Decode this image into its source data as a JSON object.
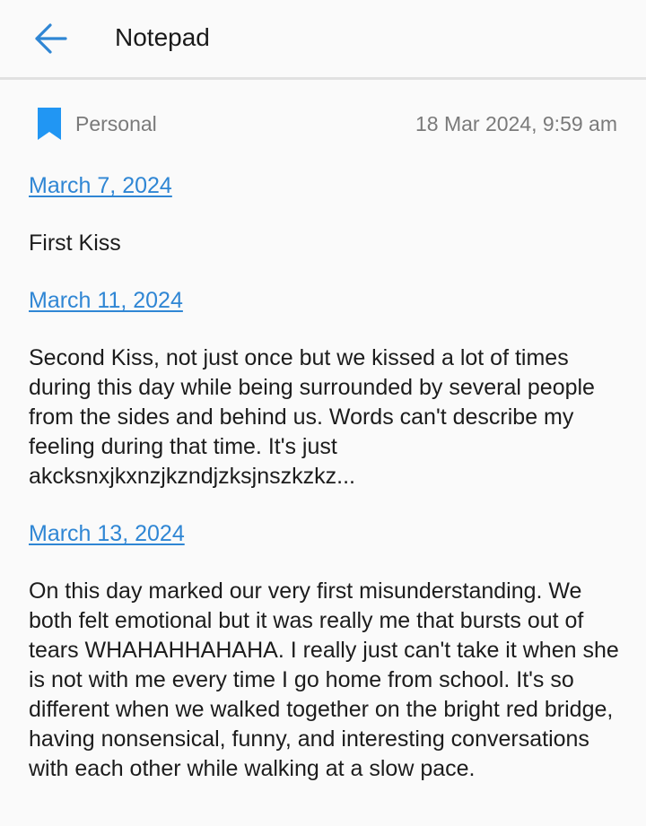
{
  "header": {
    "back_icon": "arrow-left-icon",
    "title": "Notepad"
  },
  "meta": {
    "bookmark_icon": "bookmark-icon",
    "bookmark_color": "#2196f3",
    "category": "Personal",
    "timestamp": "18 Mar 2024, 9:59 am"
  },
  "colors": {
    "link": "#2f86d4",
    "accent": "#2196f3",
    "background": "#fafafa"
  },
  "entries": [
    {
      "date": "March 7, 2024",
      "text": "First Kiss"
    },
    {
      "date": "March 11, 2024",
      "text": "Second Kiss, not just once but we kissed a lot of times during this day while being surrounded by several people from the sides and behind us. Words can't describe my feeling during that time. It's just akcksnxjkxnzjkzndjzksjnszkzkz..."
    },
    {
      "date": "March 13, 2024",
      "text": "On this day marked our very first misunderstanding. We both felt emotional but it was really me that bursts out of tears WHAHAHHAHAHA. I really just can't take it when she is not with me every time I go home from school. It's so different when we walked together on the bright red bridge, having nonsensical, funny, and interesting conversations with each other while walking at a slow pace."
    }
  ]
}
